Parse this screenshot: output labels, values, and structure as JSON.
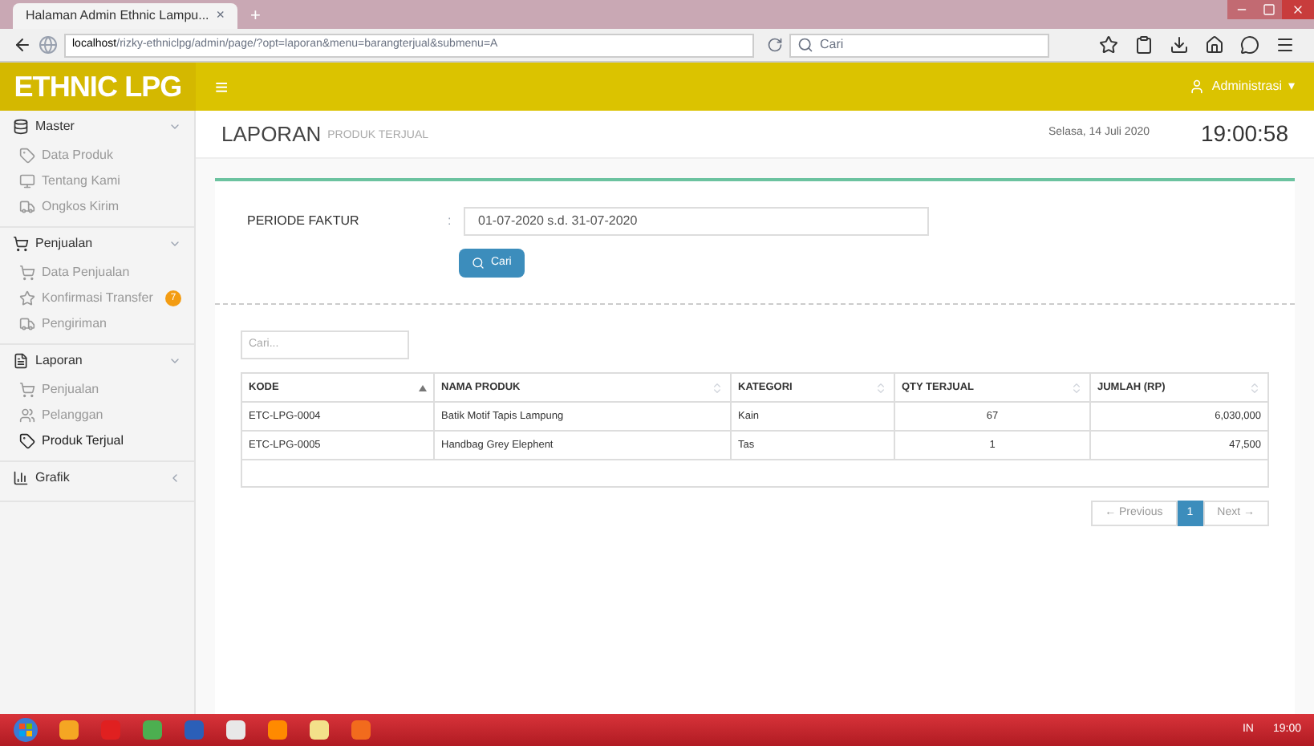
{
  "browser": {
    "tab_title": "Halaman Admin Ethnic Lampu...",
    "tab_close": "×",
    "new_tab": "+",
    "url_host": "localhost",
    "url_path": "/rizky-ethniclpg/admin/page/?opt=laporan&menu=barangterjual&submenu=A",
    "search_placeholder": "Cari"
  },
  "header": {
    "logo": "ETHNIC LPG",
    "menu_glyph": "≡",
    "user": "Administrasi",
    "user_caret": "▾"
  },
  "sidebar": {
    "groups": [
      {
        "label": "Master",
        "expanded": true,
        "items": [
          {
            "label": "Data Produk",
            "selected": false
          },
          {
            "label": "Tentang Kami",
            "selected": false
          },
          {
            "label": "Ongkos Kirim",
            "selected": false
          }
        ]
      },
      {
        "label": "Penjualan",
        "expanded": true,
        "items": [
          {
            "label": "Data Penjualan",
            "selected": false
          },
          {
            "label": "Konfirmasi Transfer",
            "selected": false,
            "badge": "7"
          },
          {
            "label": "Pengiriman",
            "selected": false
          }
        ]
      },
      {
        "label": "Laporan",
        "expanded": true,
        "items": [
          {
            "label": "Penjualan",
            "selected": false
          },
          {
            "label": "Pelanggan",
            "selected": false
          },
          {
            "label": "Produk Terjual",
            "selected": true
          }
        ]
      },
      {
        "label": "Grafik",
        "expanded": false
      }
    ]
  },
  "page": {
    "title": "LAPORAN",
    "subtitle": "PRODUK TERJUAL",
    "date": "Selasa, 14 Juli 2020",
    "time": "19:00:58"
  },
  "filter": {
    "label": "PERIODE FAKTUR",
    "separator": ":",
    "value": "01-07-2020 s.d. 31-07-2020",
    "button": "Cari"
  },
  "table": {
    "search_placeholder": "Cari...",
    "columns": [
      {
        "label": "KODE",
        "sorted": true
      },
      {
        "label": "NAMA PRODUK",
        "sorted": false
      },
      {
        "label": "KATEGORI",
        "sorted": false
      },
      {
        "label": "QTY TERJUAL",
        "sorted": false
      },
      {
        "label": "JUMLAH (RP)",
        "sorted": false
      }
    ],
    "rows": [
      [
        "ETC-LPG-0004",
        "Batik Motif Tapis Lampung",
        "Kain",
        "67",
        "6,030,000"
      ],
      [
        "ETC-LPG-0005",
        "Handbag Grey Elephent",
        "Tas",
        "1",
        "47,500"
      ]
    ]
  },
  "pagination": {
    "previous": "← Previous",
    "pages": [
      {
        "label": "1",
        "selected": true
      }
    ],
    "next": "Next →"
  },
  "taskbar": {
    "language": "IN",
    "time": "19:00"
  }
}
